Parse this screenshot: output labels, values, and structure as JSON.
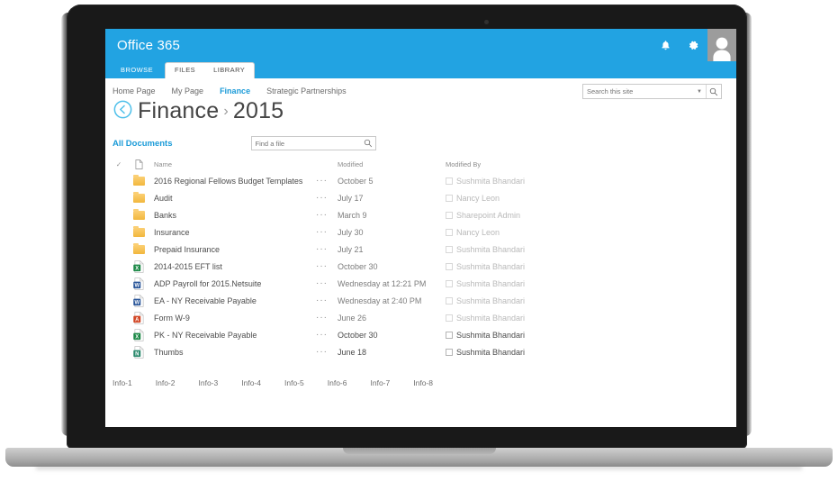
{
  "suite": {
    "title": "Office 365",
    "notifications_icon": "bell-icon",
    "settings_icon": "gear-icon",
    "avatar_icon": "user-avatar-icon"
  },
  "ribbon": {
    "tabs": [
      {
        "label": "BROWSE",
        "selected": false
      },
      {
        "label": "FILES",
        "selected": true
      },
      {
        "label": "LIBRARY",
        "selected": false
      }
    ]
  },
  "topnav": {
    "items": [
      {
        "label": "Home Page",
        "active": false
      },
      {
        "label": "My Page",
        "active": false
      },
      {
        "label": "Finance",
        "active": true
      },
      {
        "label": "Strategic Partnerships",
        "active": false
      }
    ]
  },
  "site_search": {
    "placeholder": "Search this site",
    "value": "",
    "caret_icon": "chevron-down-icon",
    "search_icon": "magnifier-icon"
  },
  "title": {
    "back_icon": "back-circle-icon",
    "parent": "Finance",
    "separator": "›",
    "current": "2015"
  },
  "viewbar": {
    "view_label": "All Documents",
    "find_placeholder": "Find a file",
    "find_value": "",
    "find_icon": "magnifier-icon"
  },
  "doclist": {
    "headers": {
      "check": "✓",
      "type_icon": "document-icon",
      "name": "Name",
      "modified": "Modified",
      "modified_by": "Modified By"
    },
    "ellipsis": "···",
    "rows": [
      {
        "icon": "folder-icon",
        "name": "2016 Regional Fellows Budget Templates",
        "modified": "October 5",
        "modified_by": "Sushmita Bhandari",
        "dim": true
      },
      {
        "icon": "folder-icon",
        "name": "Audit",
        "modified": "July 17",
        "modified_by": "Nancy Leon",
        "dim": true
      },
      {
        "icon": "folder-icon",
        "name": "Banks",
        "modified": "March 9",
        "modified_by": "Sharepoint Admin",
        "dim": true
      },
      {
        "icon": "folder-icon",
        "name": "Insurance",
        "modified": "July 30",
        "modified_by": "Nancy Leon",
        "dim": true
      },
      {
        "icon": "folder-icon",
        "name": "Prepaid Insurance",
        "modified": "July 21",
        "modified_by": "Sushmita Bhandari",
        "dim": true
      },
      {
        "icon": "excel-file-icon",
        "name": "2014-2015 EFT list",
        "modified": "October 30",
        "modified_by": "Sushmita Bhandari",
        "dim": true
      },
      {
        "icon": "word-file-icon",
        "name": "ADP Payroll for 2015.Netsuite",
        "modified": "Wednesday at 12:21 PM",
        "modified_by": "Sushmita Bhandari",
        "dim": true
      },
      {
        "icon": "word-file-icon",
        "name": "EA - NY Receivable Payable",
        "modified": "Wednesday at 2:40 PM",
        "modified_by": "Sushmita Bhandari",
        "dim": true
      },
      {
        "icon": "pdf-file-icon",
        "name": "Form W-9",
        "modified": "June 26",
        "modified_by": "Sushmita Bhandari",
        "dim": true
      },
      {
        "icon": "excel-file-icon",
        "name": "PK - NY Receivable Payable",
        "modified": "October 30",
        "modified_by": "Sushmita Bhandari",
        "dim": false
      },
      {
        "icon": "onenote-file-icon",
        "name": "Thumbs",
        "modified": "June 18",
        "modified_by": "Sushmita Bhandari",
        "dim": false
      }
    ]
  },
  "footer": {
    "links": [
      "Info-1",
      "Info-2",
      "Info-3",
      "Info-4",
      "Info-5",
      "Info-6",
      "Info-7",
      "Info-8"
    ]
  },
  "colors": {
    "suite_blue": "#22a3e2",
    "link_blue": "#1b9bd8",
    "folder_yellow": "#f2b73d",
    "excel_green": "#1f8a49",
    "word_blue": "#2a5699",
    "pdf_red": "#d24726",
    "bezel": "#191919"
  }
}
